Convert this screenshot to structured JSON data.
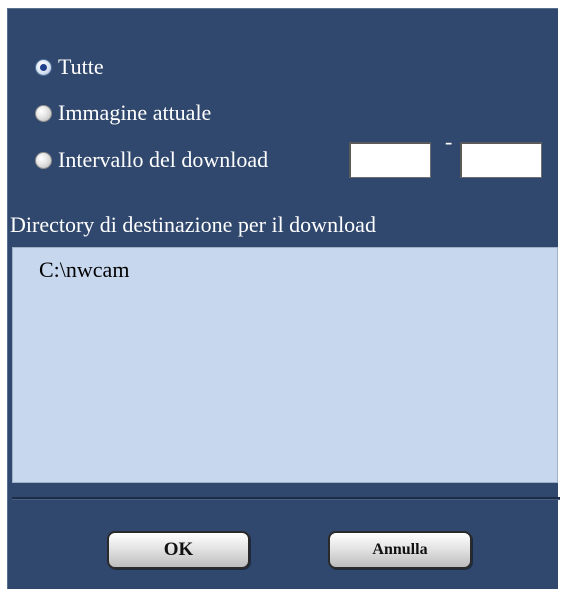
{
  "options": {
    "all_label": "Tutte",
    "current_label": "Immagine attuale",
    "range_label": "Intervallo del download",
    "selected": "all"
  },
  "range": {
    "from_value": "",
    "to_value": "",
    "separator": "-"
  },
  "destination": {
    "label": "Directory di destinazione per il download",
    "path": "C:\\nwcam"
  },
  "buttons": {
    "ok_label": "OK",
    "cancel_label": "Annulla"
  },
  "colors": {
    "dialog_background": "#30486d",
    "directory_box_background": "#c7d7ee"
  }
}
